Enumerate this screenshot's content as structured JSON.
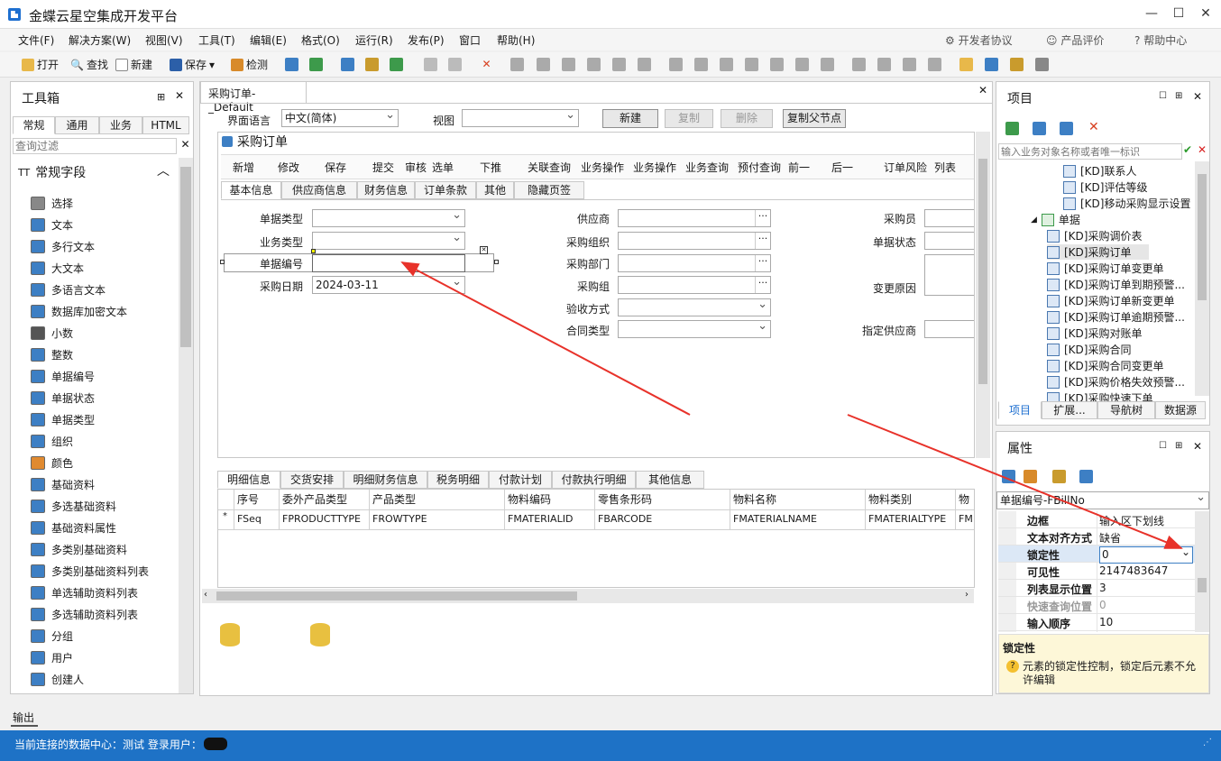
{
  "window": {
    "title": "金蝶云星空集成开发平台",
    "min": "—",
    "max": "☐",
    "close": "✕"
  },
  "menu": [
    "文件(F)",
    "解决方案(W)",
    "视图(V)",
    "工具(T)",
    "编辑(E)",
    "格式(O)",
    "运行(R)",
    "发布(P)",
    "窗口",
    "帮助(H)"
  ],
  "menu_right": {
    "dev": "开发者协议",
    "rate": "产品评价",
    "help": "帮助中心"
  },
  "toolbar": {
    "open": "打开",
    "find": "查找",
    "new": "新建",
    "save": "保存",
    "check": "检测"
  },
  "toolbox": {
    "title": "工具箱",
    "tabs": [
      "常规",
      "通用",
      "业务",
      "HTML"
    ],
    "filter_placeholder": "查询过滤",
    "group": "常规字段",
    "items": [
      "选择",
      "文本",
      "多行文本",
      "大文本",
      "多语言文本",
      "数据库加密文本",
      "小数",
      "整数",
      "单据编号",
      "单据状态",
      "单据类型",
      "组织",
      "颜色",
      "基础资料",
      "多选基础资料",
      "基础资料属性",
      "多类别基础资料",
      "多类别基础资料列表",
      "单选辅助资料列表",
      "多选辅助资料列表",
      "分组",
      "用户",
      "创建人"
    ]
  },
  "doc": {
    "tab": "采购订单-_Default",
    "lang_label": "界面语言",
    "lang_value": "中文(简体)",
    "view_label": "视图",
    "btn_new": "新建",
    "btn_copy": "复制",
    "btn_delete": "删除",
    "btn_copy_parent": "复制父节点",
    "form_title": "采购订单",
    "form_toolbar": [
      "新增",
      "修改",
      "保存",
      "提交",
      "审核",
      "选单",
      "下推",
      "关联查询",
      "业务操作",
      "业务操作",
      "业务查询",
      "预付查询",
      "前一",
      "后一",
      "订单风险",
      "列表"
    ],
    "tabs": [
      "基本信息",
      "供应商信息",
      "财务信息",
      "订单条款",
      "其他",
      "隐藏页签"
    ],
    "fields": {
      "bill_type": "单据类型",
      "biz_type": "业务类型",
      "bill_no": "单据编号",
      "date": "采购日期",
      "date_value": "2024-03-11",
      "supplier": "供应商",
      "purchase_org": "采购组织",
      "purchase_dept": "采购部门",
      "purchase_group": "采购组",
      "inspect": "验收方式",
      "contract_type": "合同类型",
      "buyer": "采购员",
      "doc_status": "单据状态",
      "change_reason": "变更原因",
      "assign_supplier": "指定供应商"
    },
    "detail_tabs": [
      "明细信息",
      "交货安排",
      "明细财务信息",
      "税务明细",
      "付款计划",
      "付款执行明细",
      "其他信息"
    ],
    "grid": {
      "headers": [
        "序号",
        "委外产品类型",
        "产品类型",
        "物料编码",
        "零售条形码",
        "物料名称",
        "物料类别",
        "物"
      ],
      "row_marker": "*",
      "cells": [
        "FSeq",
        "FPRODUCTTYPE",
        "FROWTYPE",
        "FMATERIALID",
        "FBARCODE",
        "FMATERIALNAME",
        "FMATERIALTYPE",
        "FM"
      ]
    }
  },
  "project": {
    "title": "项目",
    "search_placeholder": "输入业务对象名称或者唯一标识",
    "tree": [
      "[KD]联系人",
      "[KD]评估等级",
      "[KD]移动采购显示设置",
      "单据",
      "[KD]采购调价表",
      "[KD]采购订单",
      "[KD]采购订单变更单",
      "[KD]采购订单到期预警...",
      "[KD]采购订单新变更单",
      "[KD]采购订单逾期预警...",
      "[KD]采购对账单",
      "[KD]采购合同",
      "[KD]采购合同变更单",
      "[KD]采购价格失效预警...",
      "[KD]采购快速下单"
    ],
    "tabs": [
      "项目",
      "扩展...",
      "导航树",
      "数据源"
    ]
  },
  "props": {
    "title": "属性",
    "selector": "单据编号-FBillNo",
    "rows": [
      {
        "name": "边框",
        "value": "输入区下划线"
      },
      {
        "name": "文本对齐方式",
        "value": "缺省"
      },
      {
        "name": "锁定性",
        "value": "0"
      },
      {
        "name": "可见性",
        "value": "2147483647"
      },
      {
        "name": "列表显示位置",
        "value": "3"
      },
      {
        "name": "快速查询位置",
        "value": "0"
      },
      {
        "name": "输入顺序",
        "value": "10"
      }
    ],
    "desc_title": "锁定性",
    "desc_text": "元素的锁定性控制，锁定后元素不允许编辑"
  },
  "output": {
    "label": "输出"
  },
  "status": {
    "text": "当前连接的数据中心：测试  登录用户："
  },
  "colors": {
    "status": "#1e72c6",
    "accent": "#1e6fd0",
    "arrow": "#e8322a"
  }
}
